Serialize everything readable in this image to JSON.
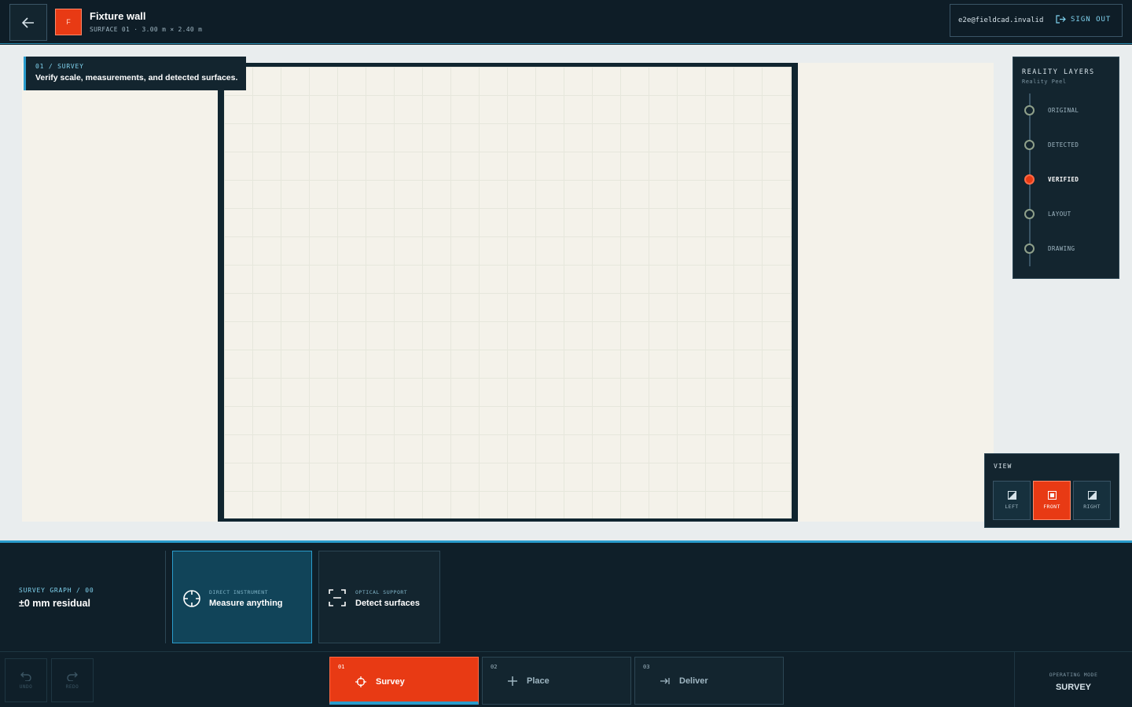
{
  "header": {
    "logo_letter": "F",
    "title": "Fixture wall",
    "subtitle": "SURFACE 01 · 3.00 m × 2.40 m",
    "account_email": "e2e@fieldcad.invalid",
    "signout_label": "SIGN OUT"
  },
  "step_banner": {
    "kicker": "01 / SURVEY",
    "message": "Verify scale, measurements, and detected surfaces."
  },
  "reality_layers": {
    "title": "REALITY LAYERS",
    "subtitle": "Reality Peel",
    "items": [
      {
        "label": "ORIGINAL",
        "active": false
      },
      {
        "label": "DETECTED",
        "active": false
      },
      {
        "label": "VERIFIED",
        "active": true
      },
      {
        "label": "LAYOUT",
        "active": false
      },
      {
        "label": "DRAWING",
        "active": false
      }
    ]
  },
  "view": {
    "title": "VIEW",
    "buttons": [
      {
        "label": "LEFT",
        "active": false
      },
      {
        "label": "FRONT",
        "active": true
      },
      {
        "label": "RIGHT",
        "active": false
      }
    ]
  },
  "survey_graph": {
    "kicker": "SURVEY GRAPH / 00",
    "value": "±0 mm residual"
  },
  "tools": [
    {
      "kicker": "DIRECT INSTRUMENT",
      "name": "Measure anything",
      "icon": "crosshair-icon",
      "active": true
    },
    {
      "kicker": "OPTICAL SUPPORT",
      "name": "Detect surfaces",
      "icon": "scan-frame-icon",
      "active": false
    }
  ],
  "history": {
    "undo_label": "UNDO",
    "redo_label": "REDO"
  },
  "stages": [
    {
      "num": "01",
      "name": "Survey",
      "icon": "target-icon",
      "active": true
    },
    {
      "num": "02",
      "name": "Place",
      "icon": "plus-icon",
      "active": false
    },
    {
      "num": "03",
      "name": "Deliver",
      "icon": "export-arrow-icon",
      "active": false
    }
  ],
  "operating_mode": {
    "label": "OPERATING MODE",
    "value": "SURVEY"
  },
  "colors": {
    "accent": "#e83a14",
    "highlight": "#2a9ccc",
    "panel": "#13252f"
  }
}
